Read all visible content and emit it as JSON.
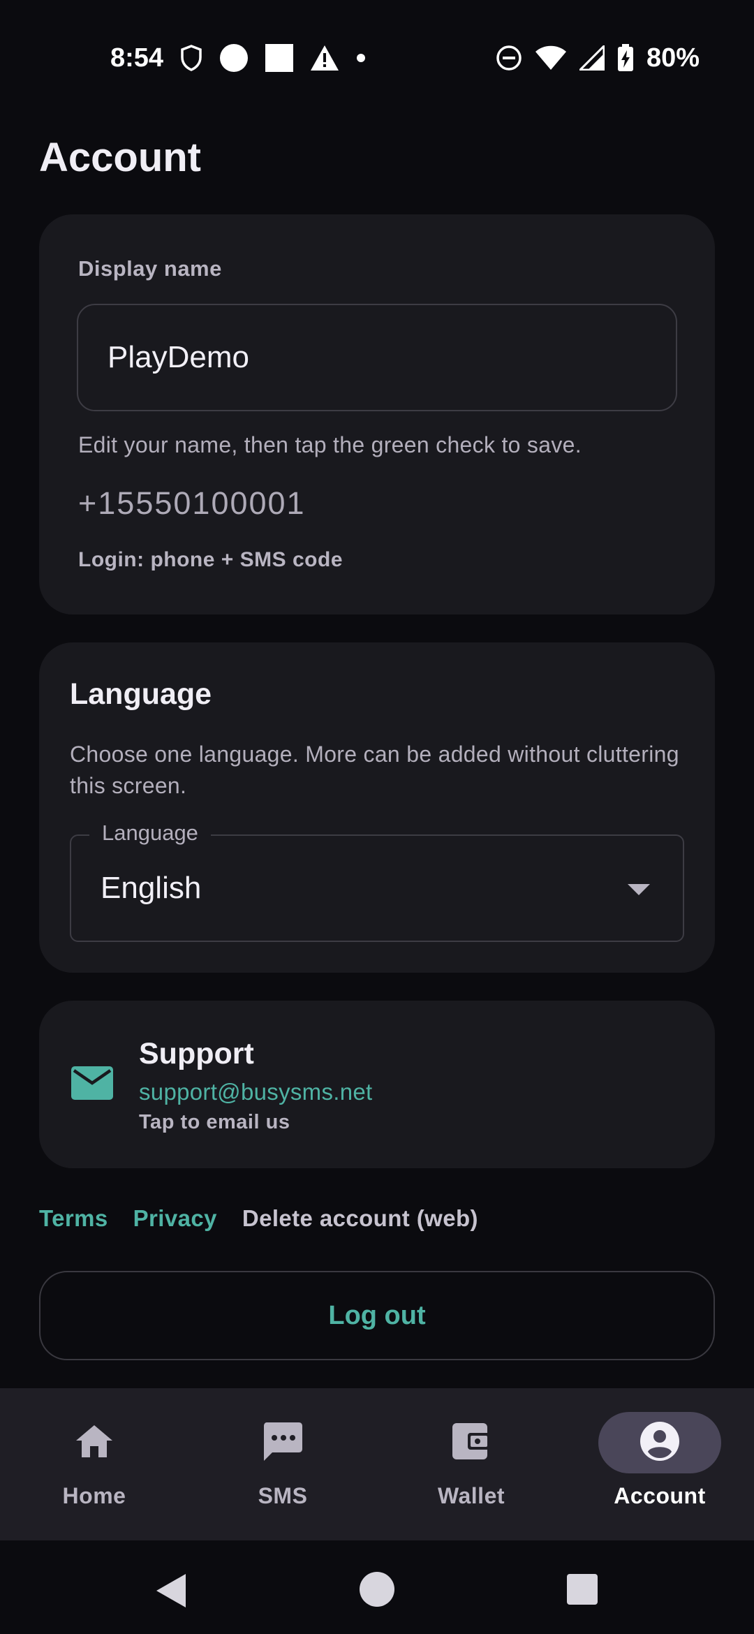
{
  "status_bar": {
    "time": "8:54",
    "battery": "80%"
  },
  "page": {
    "title": "Account"
  },
  "account_card": {
    "display_name_label": "Display name",
    "display_name_value": "PlayDemo",
    "helper_text": "Edit your name, then tap the green check to save.",
    "phone": "+15550100001",
    "login_info": "Login: phone + SMS code"
  },
  "language_card": {
    "title": "Language",
    "description": "Choose one language. More can be added without cluttering this screen.",
    "select_label": "Language",
    "selected_value": "English"
  },
  "support_card": {
    "title": "Support",
    "email": "support@busysms.net",
    "hint": "Tap to email us"
  },
  "links": {
    "terms": "Terms",
    "privacy": "Privacy",
    "delete_account": "Delete account (web)"
  },
  "logout": {
    "label": "Log out"
  },
  "bottom_nav": {
    "items": [
      {
        "label": "Home",
        "icon": "home-icon"
      },
      {
        "label": "SMS",
        "icon": "sms-icon"
      },
      {
        "label": "Wallet",
        "icon": "wallet-icon"
      },
      {
        "label": "Account",
        "icon": "account-icon"
      }
    ],
    "active_index": 3
  },
  "colors": {
    "accent": "#4fb3a4",
    "background": "#0b0b0f",
    "card": "#19191e",
    "nav_active": "#4a4659"
  }
}
